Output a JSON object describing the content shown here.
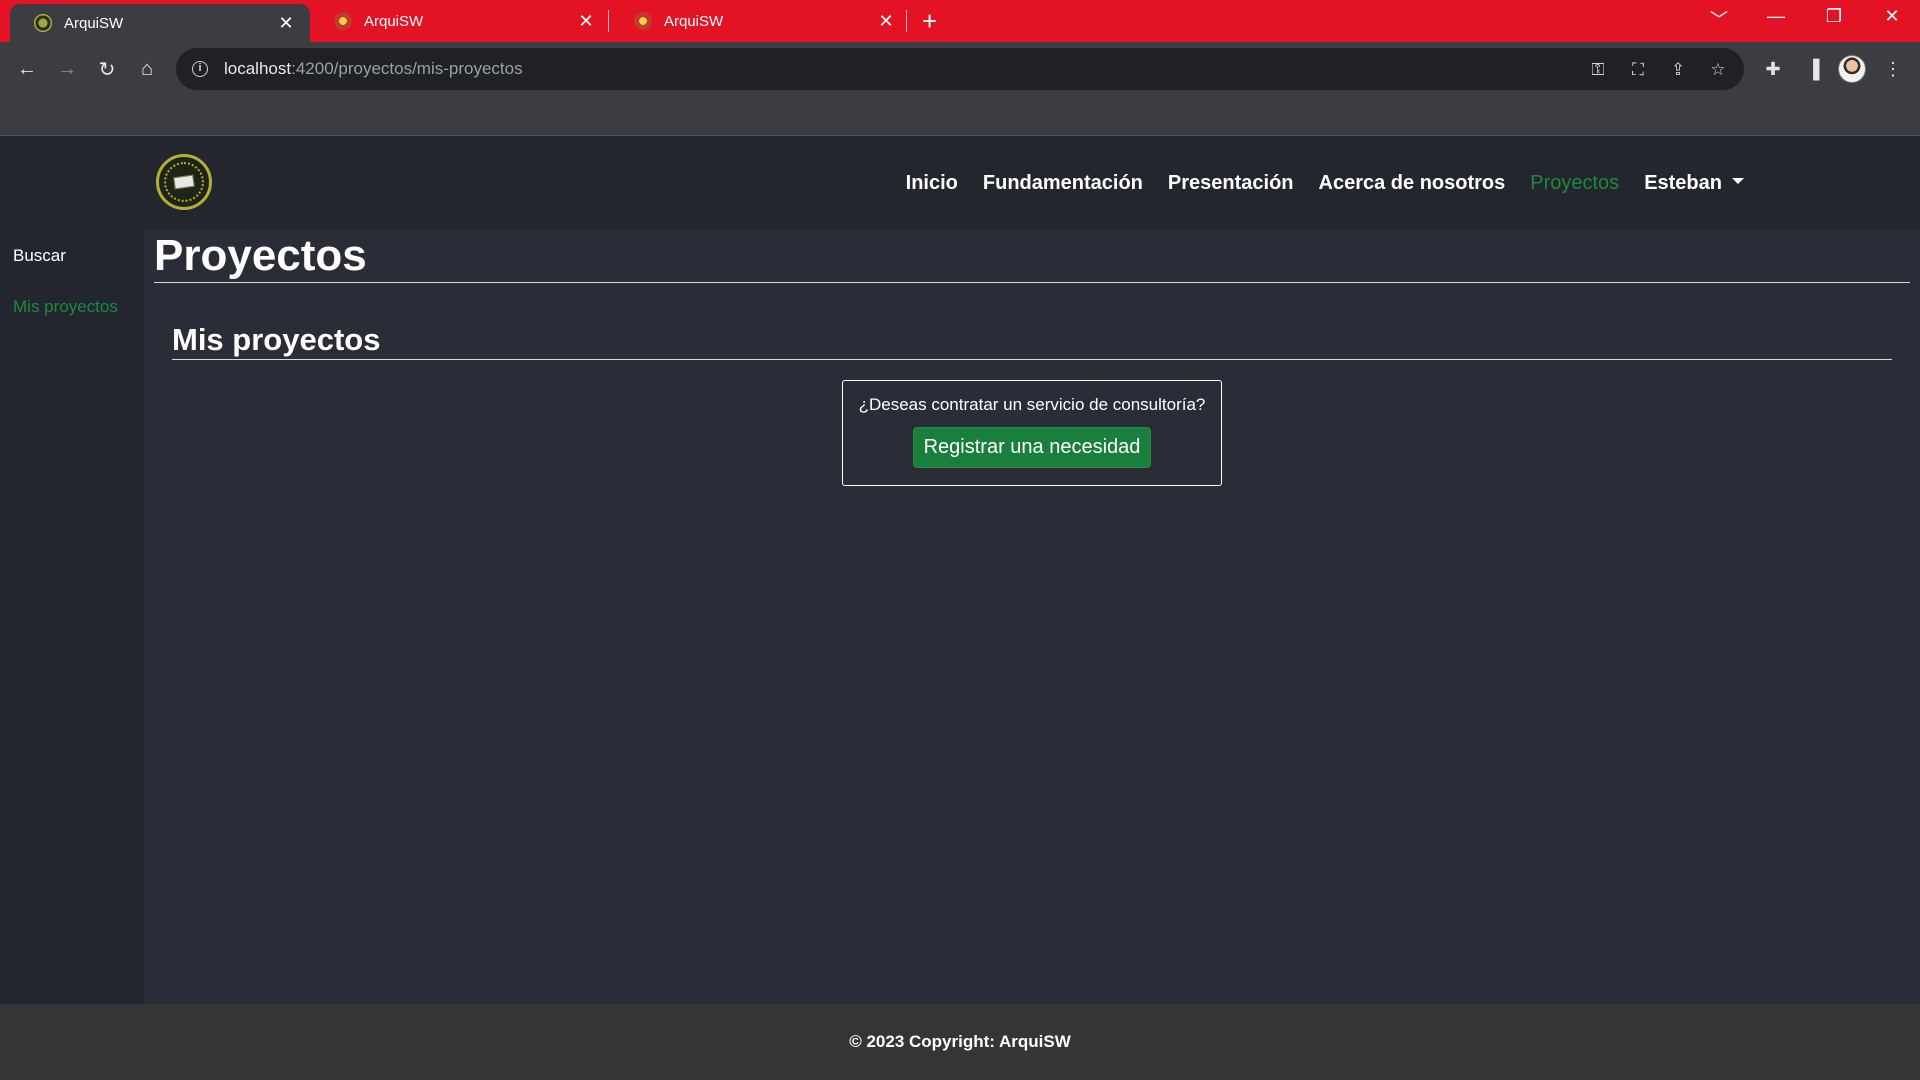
{
  "browser": {
    "tabs": [
      {
        "title": "ArquiSW",
        "active": true
      },
      {
        "title": "ArquiSW",
        "active": false
      },
      {
        "title": "ArquiSW",
        "active": false
      }
    ],
    "url_host": "localhost",
    "url_path": ":4200/proyectos/mis-proyectos",
    "tab_color": "#e31225"
  },
  "nav": {
    "items": [
      {
        "label": "Inicio"
      },
      {
        "label": "Fundamentación"
      },
      {
        "label": "Presentación"
      },
      {
        "label": "Acerca de nosotros"
      },
      {
        "label": "Proyectos",
        "active": true
      },
      {
        "label": "Esteban",
        "dropdown": true
      }
    ],
    "active_color": "#1b8a3c"
  },
  "sidebar": {
    "items": [
      {
        "label": "Buscar"
      },
      {
        "label": "Mis proyectos",
        "active": true
      }
    ]
  },
  "main": {
    "title": "Proyectos",
    "section_title": "Mis proyectos",
    "cta_question": "¿Deseas contratar un servicio de consultoría?",
    "cta_button": "Registrar una necesidad"
  },
  "footer": {
    "text": "© 2023 Copyright: ArquiSW"
  }
}
